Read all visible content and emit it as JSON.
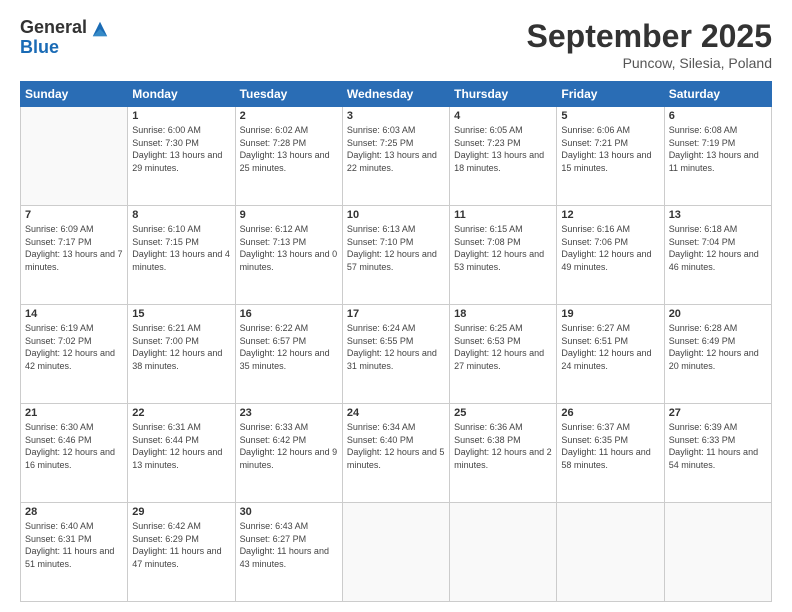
{
  "header": {
    "logo": {
      "general": "General",
      "blue": "Blue"
    },
    "title": "September 2025",
    "location": "Puncow, Silesia, Poland"
  },
  "days_of_week": [
    "Sunday",
    "Monday",
    "Tuesday",
    "Wednesday",
    "Thursday",
    "Friday",
    "Saturday"
  ],
  "weeks": [
    [
      {
        "day": "",
        "sunrise": "",
        "sunset": "",
        "daylight": ""
      },
      {
        "day": "1",
        "sunrise": "Sunrise: 6:00 AM",
        "sunset": "Sunset: 7:30 PM",
        "daylight": "Daylight: 13 hours and 29 minutes."
      },
      {
        "day": "2",
        "sunrise": "Sunrise: 6:02 AM",
        "sunset": "Sunset: 7:28 PM",
        "daylight": "Daylight: 13 hours and 25 minutes."
      },
      {
        "day": "3",
        "sunrise": "Sunrise: 6:03 AM",
        "sunset": "Sunset: 7:25 PM",
        "daylight": "Daylight: 13 hours and 22 minutes."
      },
      {
        "day": "4",
        "sunrise": "Sunrise: 6:05 AM",
        "sunset": "Sunset: 7:23 PM",
        "daylight": "Daylight: 13 hours and 18 minutes."
      },
      {
        "day": "5",
        "sunrise": "Sunrise: 6:06 AM",
        "sunset": "Sunset: 7:21 PM",
        "daylight": "Daylight: 13 hours and 15 minutes."
      },
      {
        "day": "6",
        "sunrise": "Sunrise: 6:08 AM",
        "sunset": "Sunset: 7:19 PM",
        "daylight": "Daylight: 13 hours and 11 minutes."
      }
    ],
    [
      {
        "day": "7",
        "sunrise": "Sunrise: 6:09 AM",
        "sunset": "Sunset: 7:17 PM",
        "daylight": "Daylight: 13 hours and 7 minutes."
      },
      {
        "day": "8",
        "sunrise": "Sunrise: 6:10 AM",
        "sunset": "Sunset: 7:15 PM",
        "daylight": "Daylight: 13 hours and 4 minutes."
      },
      {
        "day": "9",
        "sunrise": "Sunrise: 6:12 AM",
        "sunset": "Sunset: 7:13 PM",
        "daylight": "Daylight: 13 hours and 0 minutes."
      },
      {
        "day": "10",
        "sunrise": "Sunrise: 6:13 AM",
        "sunset": "Sunset: 7:10 PM",
        "daylight": "Daylight: 12 hours and 57 minutes."
      },
      {
        "day": "11",
        "sunrise": "Sunrise: 6:15 AM",
        "sunset": "Sunset: 7:08 PM",
        "daylight": "Daylight: 12 hours and 53 minutes."
      },
      {
        "day": "12",
        "sunrise": "Sunrise: 6:16 AM",
        "sunset": "Sunset: 7:06 PM",
        "daylight": "Daylight: 12 hours and 49 minutes."
      },
      {
        "day": "13",
        "sunrise": "Sunrise: 6:18 AM",
        "sunset": "Sunset: 7:04 PM",
        "daylight": "Daylight: 12 hours and 46 minutes."
      }
    ],
    [
      {
        "day": "14",
        "sunrise": "Sunrise: 6:19 AM",
        "sunset": "Sunset: 7:02 PM",
        "daylight": "Daylight: 12 hours and 42 minutes."
      },
      {
        "day": "15",
        "sunrise": "Sunrise: 6:21 AM",
        "sunset": "Sunset: 7:00 PM",
        "daylight": "Daylight: 12 hours and 38 minutes."
      },
      {
        "day": "16",
        "sunrise": "Sunrise: 6:22 AM",
        "sunset": "Sunset: 6:57 PM",
        "daylight": "Daylight: 12 hours and 35 minutes."
      },
      {
        "day": "17",
        "sunrise": "Sunrise: 6:24 AM",
        "sunset": "Sunset: 6:55 PM",
        "daylight": "Daylight: 12 hours and 31 minutes."
      },
      {
        "day": "18",
        "sunrise": "Sunrise: 6:25 AM",
        "sunset": "Sunset: 6:53 PM",
        "daylight": "Daylight: 12 hours and 27 minutes."
      },
      {
        "day": "19",
        "sunrise": "Sunrise: 6:27 AM",
        "sunset": "Sunset: 6:51 PM",
        "daylight": "Daylight: 12 hours and 24 minutes."
      },
      {
        "day": "20",
        "sunrise": "Sunrise: 6:28 AM",
        "sunset": "Sunset: 6:49 PM",
        "daylight": "Daylight: 12 hours and 20 minutes."
      }
    ],
    [
      {
        "day": "21",
        "sunrise": "Sunrise: 6:30 AM",
        "sunset": "Sunset: 6:46 PM",
        "daylight": "Daylight: 12 hours and 16 minutes."
      },
      {
        "day": "22",
        "sunrise": "Sunrise: 6:31 AM",
        "sunset": "Sunset: 6:44 PM",
        "daylight": "Daylight: 12 hours and 13 minutes."
      },
      {
        "day": "23",
        "sunrise": "Sunrise: 6:33 AM",
        "sunset": "Sunset: 6:42 PM",
        "daylight": "Daylight: 12 hours and 9 minutes."
      },
      {
        "day": "24",
        "sunrise": "Sunrise: 6:34 AM",
        "sunset": "Sunset: 6:40 PM",
        "daylight": "Daylight: 12 hours and 5 minutes."
      },
      {
        "day": "25",
        "sunrise": "Sunrise: 6:36 AM",
        "sunset": "Sunset: 6:38 PM",
        "daylight": "Daylight: 12 hours and 2 minutes."
      },
      {
        "day": "26",
        "sunrise": "Sunrise: 6:37 AM",
        "sunset": "Sunset: 6:35 PM",
        "daylight": "Daylight: 11 hours and 58 minutes."
      },
      {
        "day": "27",
        "sunrise": "Sunrise: 6:39 AM",
        "sunset": "Sunset: 6:33 PM",
        "daylight": "Daylight: 11 hours and 54 minutes."
      }
    ],
    [
      {
        "day": "28",
        "sunrise": "Sunrise: 6:40 AM",
        "sunset": "Sunset: 6:31 PM",
        "daylight": "Daylight: 11 hours and 51 minutes."
      },
      {
        "day": "29",
        "sunrise": "Sunrise: 6:42 AM",
        "sunset": "Sunset: 6:29 PM",
        "daylight": "Daylight: 11 hours and 47 minutes."
      },
      {
        "day": "30",
        "sunrise": "Sunrise: 6:43 AM",
        "sunset": "Sunset: 6:27 PM",
        "daylight": "Daylight: 11 hours and 43 minutes."
      },
      {
        "day": "",
        "sunrise": "",
        "sunset": "",
        "daylight": ""
      },
      {
        "day": "",
        "sunrise": "",
        "sunset": "",
        "daylight": ""
      },
      {
        "day": "",
        "sunrise": "",
        "sunset": "",
        "daylight": ""
      },
      {
        "day": "",
        "sunrise": "",
        "sunset": "",
        "daylight": ""
      }
    ]
  ]
}
